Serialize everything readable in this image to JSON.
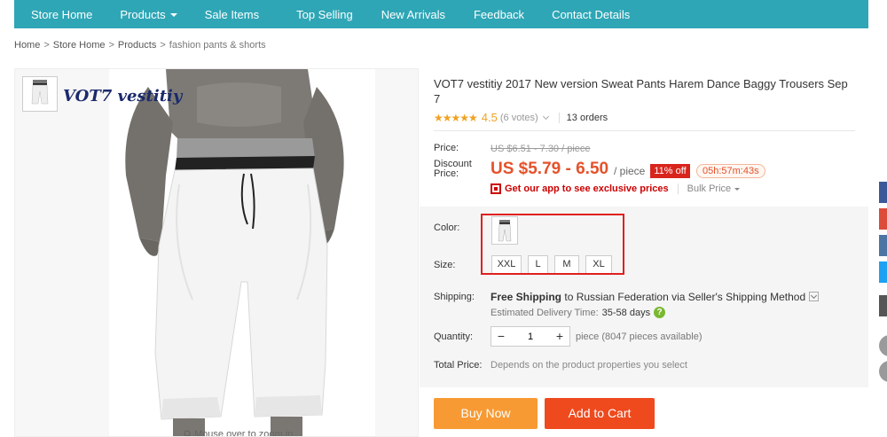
{
  "nav": {
    "items": [
      {
        "label": "Store Home"
      },
      {
        "label": "Products"
      },
      {
        "label": "Sale Items"
      },
      {
        "label": "Top Selling"
      },
      {
        "label": "New Arrivals"
      },
      {
        "label": "Feedback"
      },
      {
        "label": "Contact Details"
      }
    ],
    "bg_color": "#2ea6b6"
  },
  "breadcrumb": {
    "items": [
      "Home",
      "Store Home",
      "Products"
    ],
    "separator": ">",
    "current": "fashion pants & shorts"
  },
  "gallery": {
    "brand": "VOT7 vestitiy",
    "zoom_hint": "Mouse over to zoom in"
  },
  "product": {
    "title": "VOT7 vestitiy 2017 New version Sweat Pants Harem Dance Baggy Trousers Sep 7",
    "stars": "★★★★★",
    "rating": "4.5",
    "votes": "(6 votes)",
    "orders": "13 orders",
    "price_label": "Price:",
    "original_price": "US $6.51 - 7.30 / piece",
    "discount_label_1": "Discount",
    "discount_label_2": "Price:",
    "discount_price": "US $5.79 - 6.50",
    "per_piece": "/ piece",
    "discount_badge": "11% off",
    "countdown": "05h:57m:43s",
    "app_promo": "Get our app to see exclusive prices",
    "bulk_price": "Bulk Price",
    "color_label": "Color:",
    "size_label": "Size:",
    "sizes": [
      "XXL",
      "L",
      "M",
      "XL"
    ],
    "shipping_label": "Shipping:",
    "shipping_free": "Free Shipping",
    "shipping_rest": "to Russian Federation via Seller's Shipping Method",
    "delivery_label": "Estimated Delivery Time:",
    "delivery_days": "35-58 days",
    "quantity_label": "Quantity:",
    "quantity_value": "1",
    "minus": "−",
    "plus": "+",
    "availability_unit": "piece",
    "availability": "(8047 pieces available)",
    "total_label": "Total Price:",
    "total_value": "Depends on the product properties you select",
    "buy_now": "Buy Now",
    "add_to_cart": "Add to Cart",
    "accent_orange": "#f79a33",
    "accent_red": "#ee4a1e",
    "price_color": "#e5522b"
  },
  "social": {
    "colors": [
      "#3b5998",
      "#dd4b39",
      "#4c75a3",
      "#1da1f2",
      "#555555"
    ]
  },
  "icons": [
    "search-icon",
    "qr-code-icon",
    "question-icon",
    "star-icon",
    "chevron-down-icon"
  ]
}
